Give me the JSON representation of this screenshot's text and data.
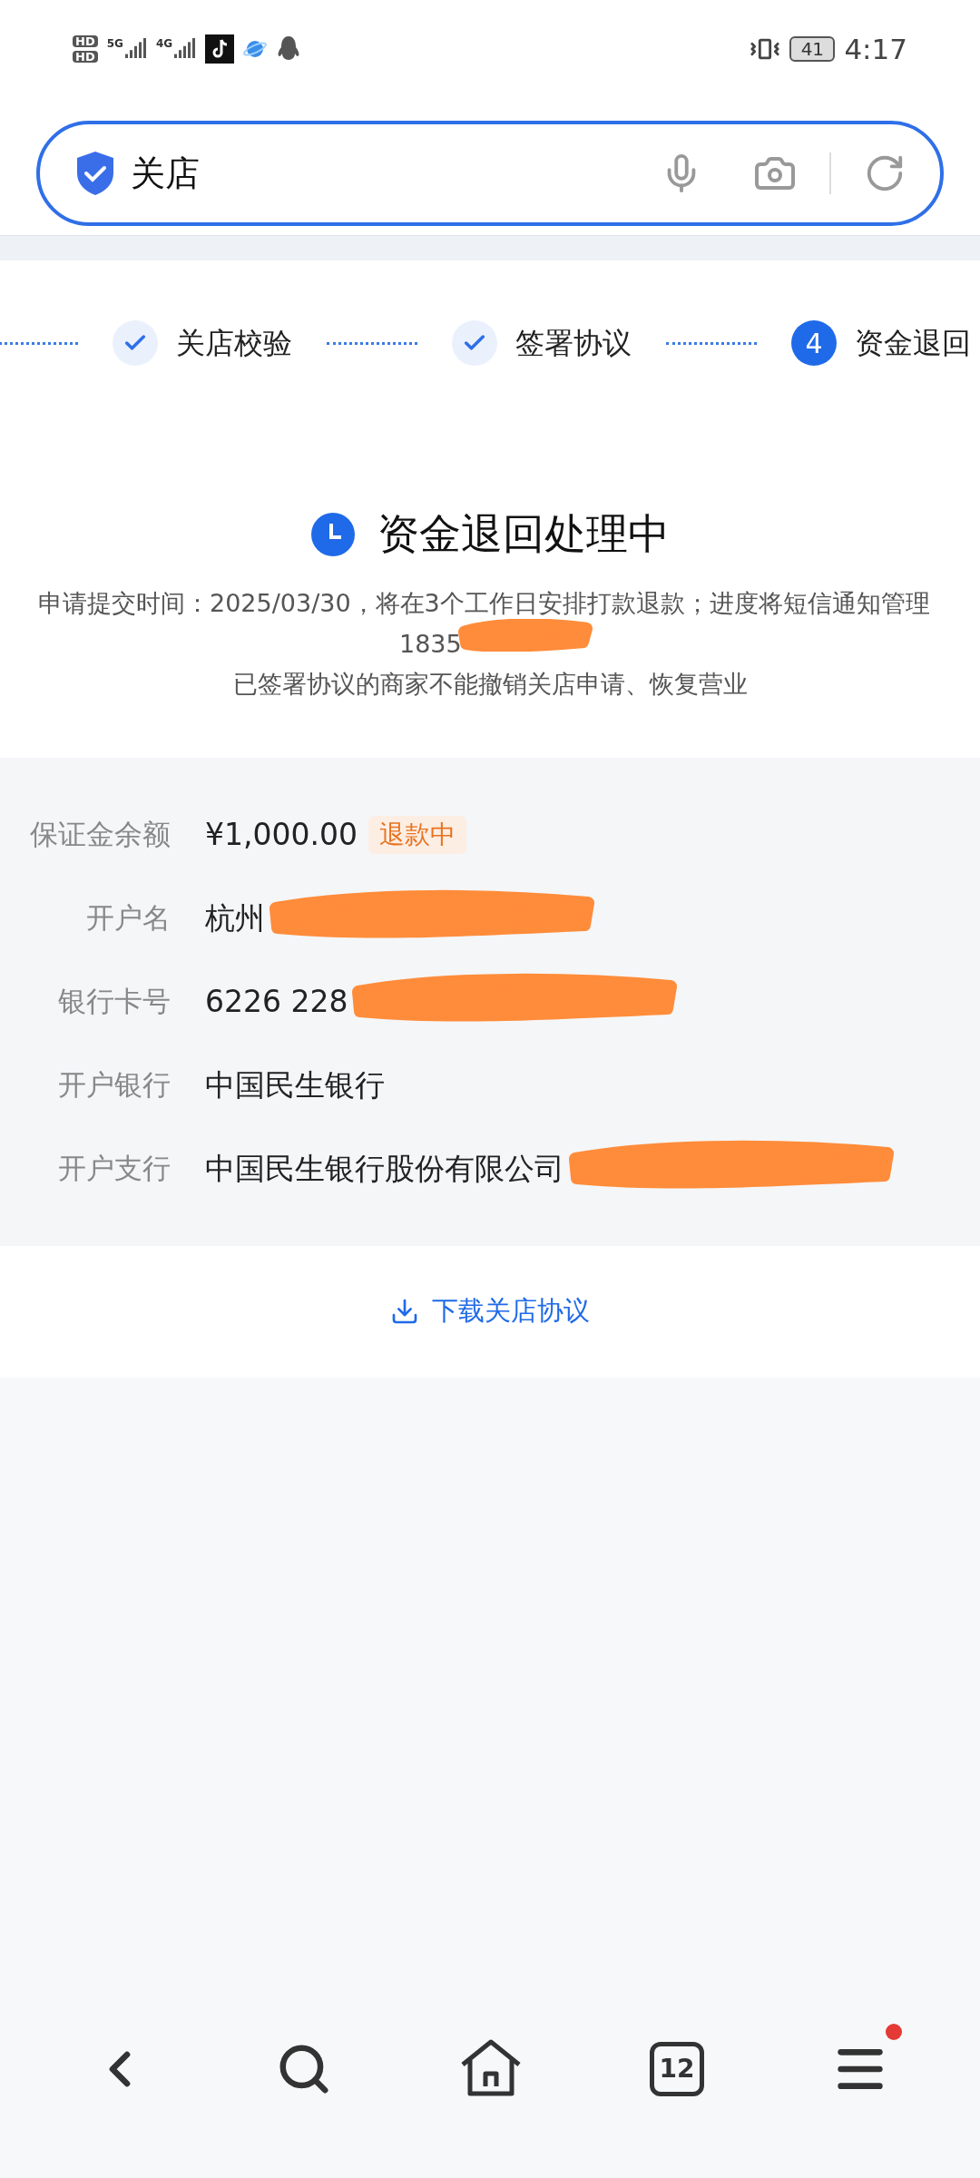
{
  "status_bar": {
    "sim_labels": [
      "HD",
      "HD"
    ],
    "networks": [
      "5G",
      "4G"
    ],
    "battery": "41",
    "time": "4:17"
  },
  "search": {
    "value": "关店"
  },
  "steps": [
    {
      "label": "关店校验",
      "completed": true
    },
    {
      "label": "签署协议",
      "completed": true
    },
    {
      "number": "4",
      "label": "资金退回",
      "completed": false
    }
  ],
  "result": {
    "title": "资金退回处理中",
    "description": "申请提交时间：2025/03/30，将在3个工作日安排打款退款；进度将短信通知管理",
    "phone": "1835",
    "note": "已签署协议的商家不能撤销关店申请、恢复营业"
  },
  "details": [
    {
      "label": "保证金余额",
      "value": "¥1,000.00",
      "badge": "退款中",
      "redacted": false
    },
    {
      "label": "开户名",
      "value": "杭州",
      "redacted": true
    },
    {
      "label": "银行卡号",
      "value": "6226 228",
      "redacted": true
    },
    {
      "label": "开户银行",
      "value": "中国民生银行",
      "redacted": false
    },
    {
      "label": "开户支行",
      "value": "中国民生银行股份有限公司",
      "redacted": true
    }
  ],
  "download_link": "下载关店协议",
  "nav": {
    "tabs_count": "12",
    "menu_badge": true
  }
}
